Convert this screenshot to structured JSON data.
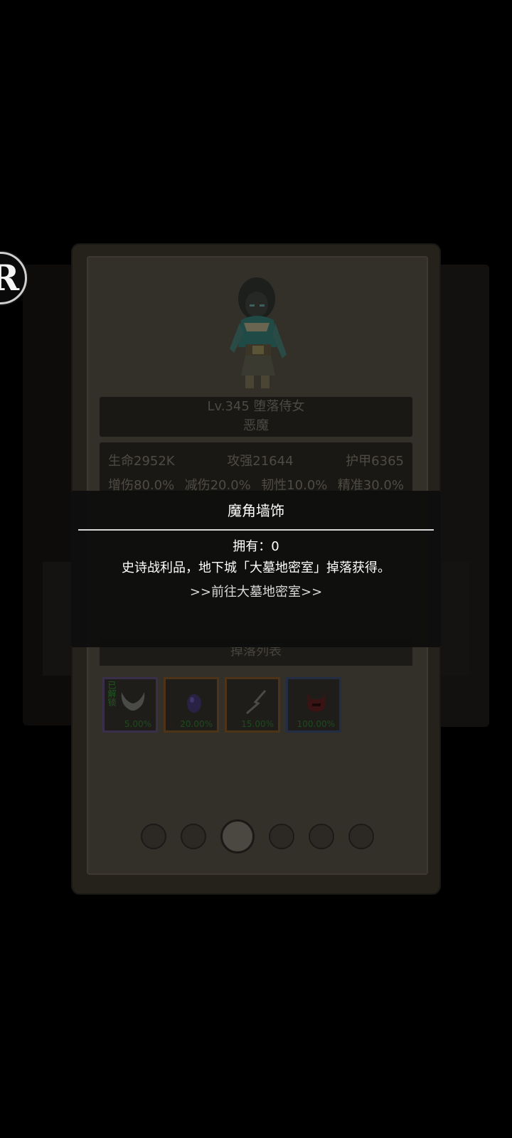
{
  "badge": {
    "letter": "R"
  },
  "monster": {
    "name_line": "Lv.345 堕落侍女",
    "type": "恶魔"
  },
  "stats": {
    "row1": [
      "生命2952K",
      "攻强21644",
      "护甲6365"
    ],
    "row2": [
      "增伤80.0%",
      "减伤20.0%",
      "韧性10.0%",
      "精准30.0%"
    ]
  },
  "drops": {
    "header": "掉落列表",
    "items": [
      {
        "icon": "demon-horn-icon",
        "rate": "5.00%",
        "tag": "已解锁",
        "rarity": "epic"
      },
      {
        "icon": "purple-gem-icon",
        "rate": "20.00%",
        "rarity": "legendary"
      },
      {
        "icon": "broken-staff-icon",
        "rate": "15.00%",
        "rarity": "legendary"
      },
      {
        "icon": "demon-helmet-icon",
        "rate": "100.00%",
        "rarity": "rare"
      }
    ]
  },
  "pager": {
    "count": 6,
    "active_index": 2
  },
  "popup": {
    "title": "魔角墙饰",
    "owned": "拥有：0",
    "description": "史诗战利品，地下城「大墓地密室」掉落获得。",
    "link": ">>前往大墓地密室>>"
  },
  "colors": {
    "background": "#000000",
    "card": "#25221c",
    "popup": "#0e0e0e",
    "rate_text": "#1d4a1d"
  }
}
